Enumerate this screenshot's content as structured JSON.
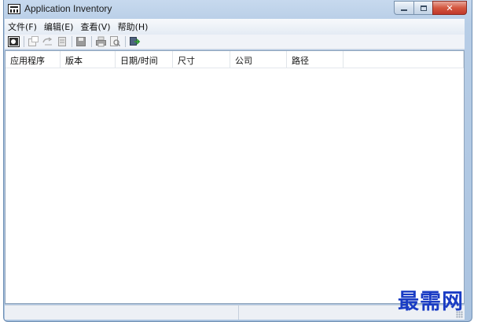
{
  "window": {
    "title": "Application Inventory",
    "controls": {
      "minimize": "minimize-icon",
      "maximize": "maximize-icon",
      "close": "close-icon"
    }
  },
  "menu": {
    "items": [
      {
        "label": "文件(F)"
      },
      {
        "label": "编辑(E)"
      },
      {
        "label": "查看(V)"
      },
      {
        "label": "帮助(H)"
      }
    ]
  },
  "toolbar": {
    "buttons": [
      "view-icon",
      "properties-icon",
      "refresh-icon",
      "copy-icon",
      "save-icon",
      "print-icon",
      "print-preview-icon",
      "exit-icon"
    ]
  },
  "list": {
    "columns": [
      {
        "label": "应用程序"
      },
      {
        "label": "版本"
      },
      {
        "label": "日期/时间"
      },
      {
        "label": "尺寸"
      },
      {
        "label": "公司"
      },
      {
        "label": "路径"
      }
    ],
    "rows": []
  },
  "status": {
    "pane1": "",
    "pane2": ""
  },
  "watermark": "最需网",
  "colors": {
    "title_gradient": "#b7cde6",
    "close_button": "#c0382a",
    "watermark": "#1a3cc4"
  }
}
